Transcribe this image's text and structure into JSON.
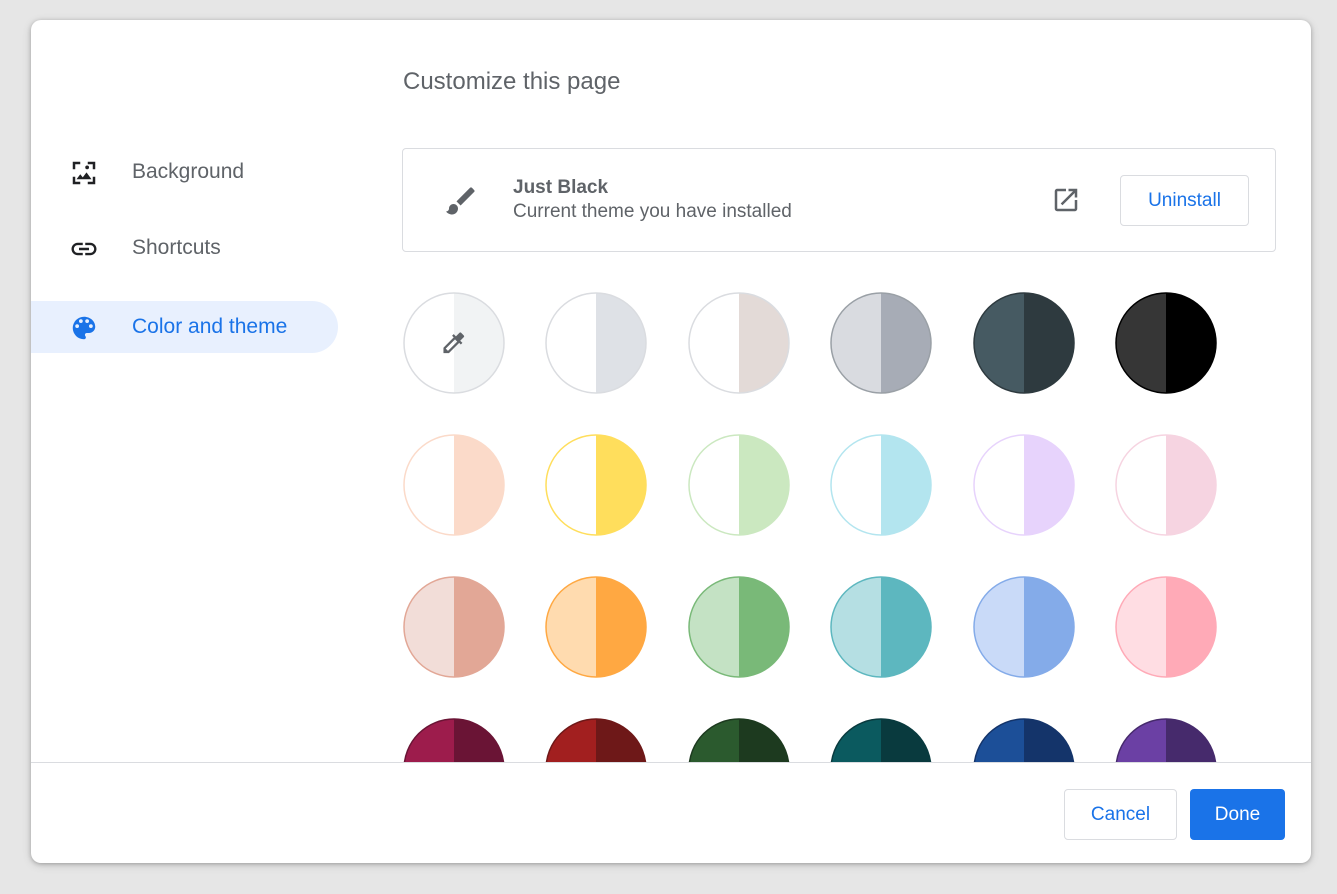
{
  "dialog": {
    "title": "Customize this page"
  },
  "sidebar": {
    "items": [
      {
        "label": "Background",
        "icon": "background-image-icon",
        "active": false
      },
      {
        "label": "Shortcuts",
        "icon": "link-icon",
        "active": false
      },
      {
        "label": "Color and theme",
        "icon": "palette-icon",
        "active": true
      }
    ]
  },
  "theme": {
    "name": "Just Black",
    "description": "Current theme you have installed",
    "icon": "paintbrush-icon",
    "open_icon": "open-in-new-icon",
    "uninstall_label": "Uninstall"
  },
  "swatches": [
    [
      {
        "left": "#ffffff",
        "right": "#f1f3f4",
        "border": "#dadce0",
        "icon": "eyedropper-icon"
      },
      {
        "left": "#ffffff",
        "right": "#dee1e6",
        "border": "#dadce0"
      },
      {
        "left": "#ffffff",
        "right": "#e3dad7",
        "border": "#dadce0"
      },
      {
        "left": "#d9dbe0",
        "right": "#a7acb6",
        "border": "#9aa0a6"
      },
      {
        "left": "#465a62",
        "right": "#2e3a3f",
        "border": "#2e3a3f"
      },
      {
        "left": "#363636",
        "right": "#000000",
        "border": "#000000"
      }
    ],
    [
      {
        "left": "#ffffff",
        "right": "#fbdac9",
        "border": "#fbdac9"
      },
      {
        "left": "#ffffff",
        "right": "#ffde5c",
        "border": "#ffde5c"
      },
      {
        "left": "#ffffff",
        "right": "#cbe8c0",
        "border": "#cbe8c0"
      },
      {
        "left": "#ffffff",
        "right": "#b3e5ef",
        "border": "#b3e5ef"
      },
      {
        "left": "#ffffff",
        "right": "#e7d3fc",
        "border": "#e7d3fc"
      },
      {
        "left": "#ffffff",
        "right": "#f6d4e1",
        "border": "#f6d4e1"
      }
    ],
    [
      {
        "left": "#f2ddd8",
        "right": "#e2a796",
        "border": "#e2a796"
      },
      {
        "left": "#ffdbaf",
        "right": "#ffa842",
        "border": "#ffa842"
      },
      {
        "left": "#c4e2c4",
        "right": "#79b978",
        "border": "#79b978"
      },
      {
        "left": "#b5dfe3",
        "right": "#5db7bf",
        "border": "#5db7bf"
      },
      {
        "left": "#c9daf8",
        "right": "#84abe9",
        "border": "#84abe9"
      },
      {
        "left": "#ffdde3",
        "right": "#ffaab7",
        "border": "#ffaab7"
      }
    ],
    [
      {
        "left": "#9d1c4c",
        "right": "#6a1435",
        "border": "#6a1435"
      },
      {
        "left": "#a21f1f",
        "right": "#6e1818",
        "border": "#6e1818"
      },
      {
        "left": "#2b5a2e",
        "right": "#1d3a1f",
        "border": "#1d3a1f"
      },
      {
        "left": "#0b5a5f",
        "right": "#093a3e",
        "border": "#093a3e"
      },
      {
        "left": "#1c4f98",
        "right": "#14346a",
        "border": "#14346a"
      },
      {
        "left": "#6b40a4",
        "right": "#462a6c",
        "border": "#462a6c"
      }
    ]
  ],
  "footer": {
    "cancel_label": "Cancel",
    "done_label": "Done"
  }
}
